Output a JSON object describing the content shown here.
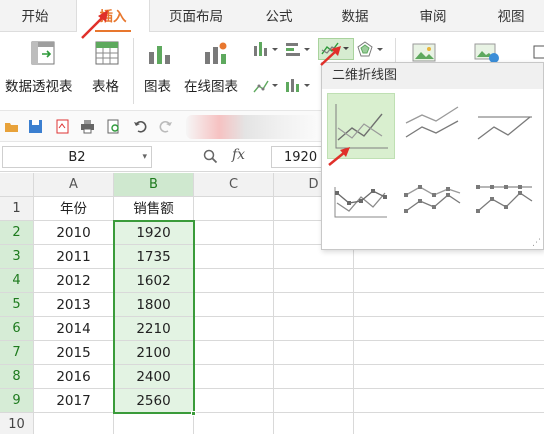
{
  "tabs": [
    {
      "label": "开始",
      "active": false
    },
    {
      "label": "插入",
      "active": true
    },
    {
      "label": "页面布局",
      "active": false
    },
    {
      "label": "公式",
      "active": false
    },
    {
      "label": "数据",
      "active": false
    },
    {
      "label": "审阅",
      "active": false
    },
    {
      "label": "视图",
      "active": false
    }
  ],
  "ribbon": {
    "pivot_label": "数据透视表",
    "table_label": "表格",
    "chart_label": "图表",
    "online_chart_label": "在线图表"
  },
  "formula_bar": {
    "name_box": "B2",
    "fx": "fx",
    "value": "1920"
  },
  "sheet": {
    "columns": [
      "A",
      "B",
      "C",
      "D"
    ],
    "rows": [
      {
        "n": "1",
        "a": "年份",
        "b": "销售额"
      },
      {
        "n": "2",
        "a": "2010",
        "b": "1920"
      },
      {
        "n": "3",
        "a": "2011",
        "b": "1735"
      },
      {
        "n": "4",
        "a": "2012",
        "b": "1602"
      },
      {
        "n": "5",
        "a": "2013",
        "b": "1800"
      },
      {
        "n": "6",
        "a": "2014",
        "b": "2210"
      },
      {
        "n": "7",
        "a": "2015",
        "b": "2100"
      },
      {
        "n": "8",
        "a": "2016",
        "b": "2400"
      },
      {
        "n": "9",
        "a": "2017",
        "b": "2560"
      },
      {
        "n": "10",
        "a": "",
        "b": ""
      }
    ]
  },
  "chart_menu": {
    "title": "二维折线图"
  },
  "colors": {
    "accent": "#e8772e",
    "selection": "#3a9b3a",
    "arrow": "#e0302a"
  }
}
